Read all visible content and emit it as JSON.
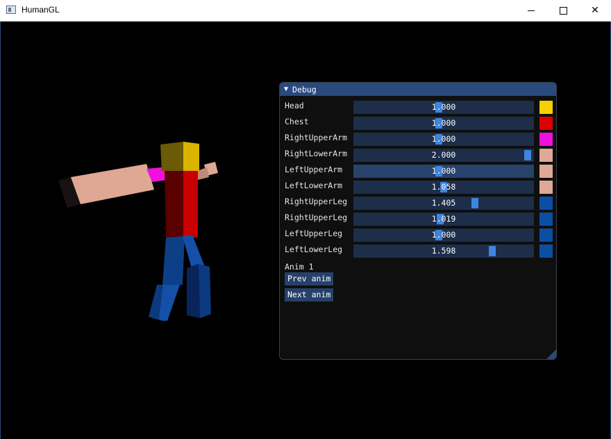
{
  "window": {
    "title": "HumanGL"
  },
  "panel": {
    "title": "Debug",
    "rows": [
      {
        "label": "Head",
        "value": "1.000",
        "fraction": 0.0,
        "color": "#f7d000"
      },
      {
        "label": "Chest",
        "value": "1.000",
        "fraction": 0.0,
        "color": "#dd0000"
      },
      {
        "label": "RightUpperArm",
        "value": "1.000",
        "fraction": 0.0,
        "color": "#ee11dd"
      },
      {
        "label": "RightLowerArm",
        "value": "2.000",
        "fraction": 1.0,
        "color": "#dfa894"
      },
      {
        "label": "LeftUpperArm",
        "value": "1.000",
        "fraction": 0.0,
        "color": "#dfa894"
      },
      {
        "label": "LeftLowerArm",
        "value": "1.058",
        "fraction": 0.058,
        "color": "#dfa894"
      },
      {
        "label": "RightUpperLeg",
        "value": "1.405",
        "fraction": 0.405,
        "color": "#0a4fa3"
      },
      {
        "label": "RightUpperLeg",
        "value": "1.019",
        "fraction": 0.019,
        "color": "#0a4fa3"
      },
      {
        "label": "LeftUpperLeg",
        "value": "1.000",
        "fraction": 0.0,
        "color": "#0a4fa3"
      },
      {
        "label": "LeftLowerLeg",
        "value": "1.598",
        "fraction": 0.598,
        "color": "#0a4fa3"
      }
    ],
    "anim_label": "Anim 1",
    "prev_anim": "Prev anim",
    "next_anim": "Next anim"
  }
}
